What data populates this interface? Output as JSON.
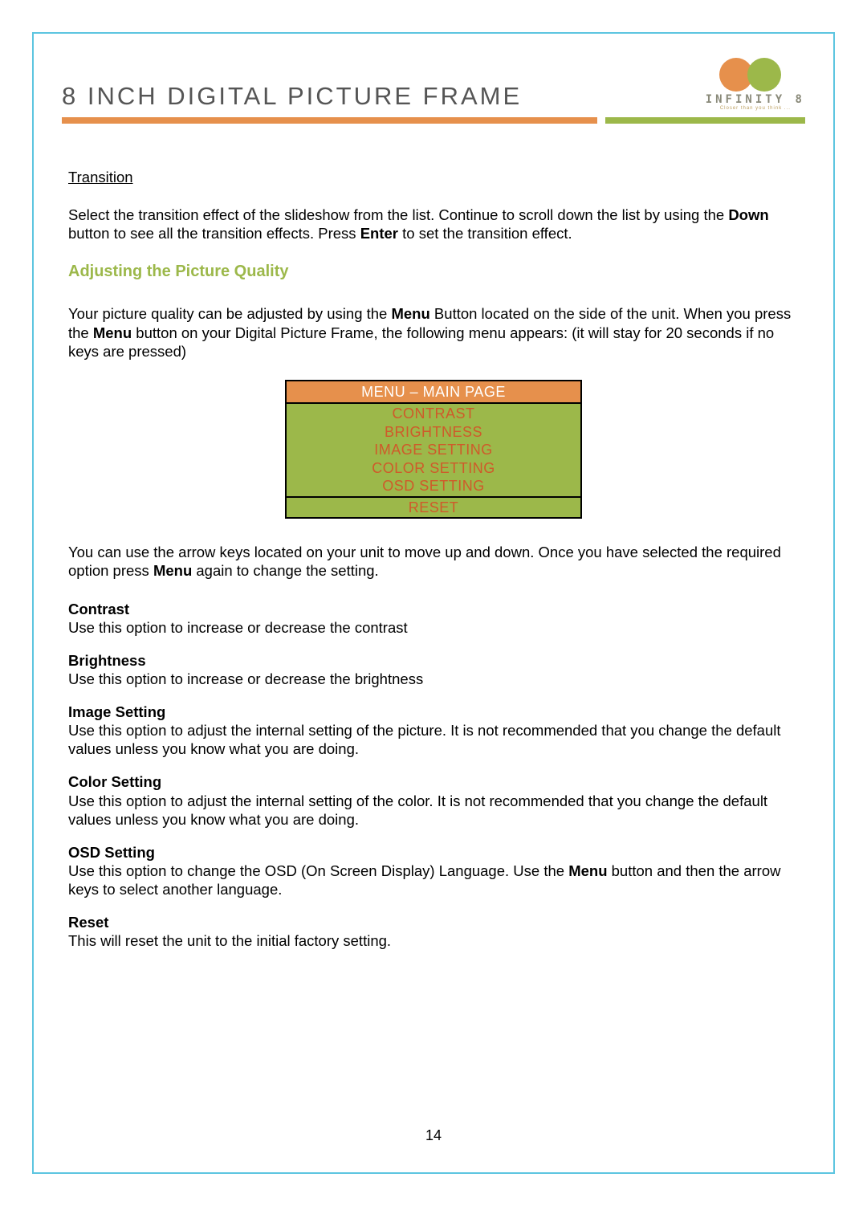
{
  "header": {
    "title": "8 INCH DIGITAL PICTURE FRAME",
    "logo_text": "INFINITY 8",
    "logo_tagline": "Closer than you think ..."
  },
  "transition": {
    "label": "Transition",
    "body_part1": "Select the transition effect of the slideshow from the list. Continue to scroll down the list by using the ",
    "down": "Down",
    "body_part2": " button to see all the transition effects. Press ",
    "enter": "Enter",
    "body_part3": " to set the transition effect."
  },
  "adjusting": {
    "heading": "Adjusting the Picture Quality",
    "intro_part1": "Your picture quality can be adjusted by using the ",
    "menu1": "Menu",
    "intro_part2": " Button located on the side of the unit. When you press the ",
    "menu2": "Menu",
    "intro_part3": " button on your Digital Picture Frame, the following menu appears: (it will stay for 20 seconds if no keys are pressed)"
  },
  "menu_table": {
    "header": "MENU – MAIN PAGE",
    "items": [
      "CONTRAST",
      "BRIGHTNESS",
      "IMAGE SETTING",
      "COLOR SETTING",
      "OSD SETTING"
    ],
    "footer": "RESET"
  },
  "after_table": {
    "part1": "You can use the arrow keys located on your unit to move up and down. Once you have selected the required option press ",
    "menu": "Menu",
    "part2": " again to change the setting."
  },
  "options": {
    "contrast": {
      "title": "Contrast",
      "body": "Use this option to increase or decrease the contrast"
    },
    "brightness": {
      "title": "Brightness",
      "body": "Use this option to increase or decrease the brightness"
    },
    "image_setting": {
      "title": "Image Setting",
      "body": "Use this option to adjust the internal setting of the picture. It is not recommended that you change the default values unless you know what you are doing."
    },
    "color_setting": {
      "title": "Color Setting",
      "body": "Use this option to adjust the internal setting of the color. It is not recommended that you change the default values unless you know what you are doing."
    },
    "osd_setting": {
      "title": "OSD Setting",
      "body_part1": "Use this option to change the OSD (On Screen Display) Language. Use the ",
      "menu": "Menu",
      "body_part2": " button and then the arrow keys to select another language."
    },
    "reset": {
      "title": "Reset",
      "body": "This will reset the unit to the initial factory setting."
    }
  },
  "page_number": "14"
}
